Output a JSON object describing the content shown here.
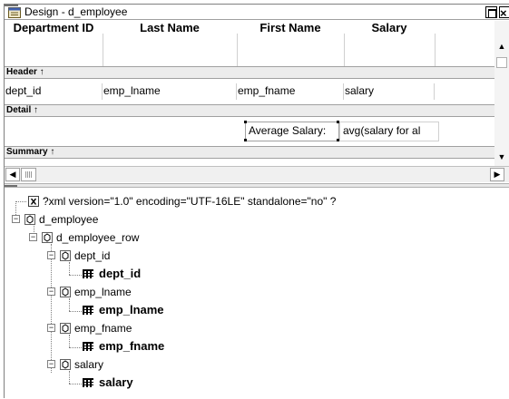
{
  "window": {
    "title": "Design - d_employee"
  },
  "design": {
    "columns": [
      "Department ID",
      "Last Name",
      "First Name",
      "Salary"
    ],
    "bands": {
      "header": "Header ↑",
      "detail": "Detail ↑",
      "summary": "Summary ↑"
    },
    "detail_fields": [
      "dept_id",
      "emp_lname",
      "emp_fname",
      "salary"
    ],
    "summary": {
      "label": "Average Salary:",
      "expression": "avg(salary for al"
    }
  },
  "tree": {
    "xml_decl": "?xml version=\"1.0\" encoding=\"UTF-16LE\" standalone=\"no\" ?",
    "root": "d_employee",
    "row": "d_employee_row",
    "elements": [
      {
        "name": "dept_id",
        "value": "dept_id"
      },
      {
        "name": "emp_lname",
        "value": "emp_lname"
      },
      {
        "name": "emp_fname",
        "value": "emp_fname"
      },
      {
        "name": "salary",
        "value": "salary"
      }
    ]
  },
  "icons": {
    "title": "datawindow-icon",
    "xml": "xml-declaration-icon",
    "element": "xml-element-icon",
    "text": "column-value-icon"
  }
}
